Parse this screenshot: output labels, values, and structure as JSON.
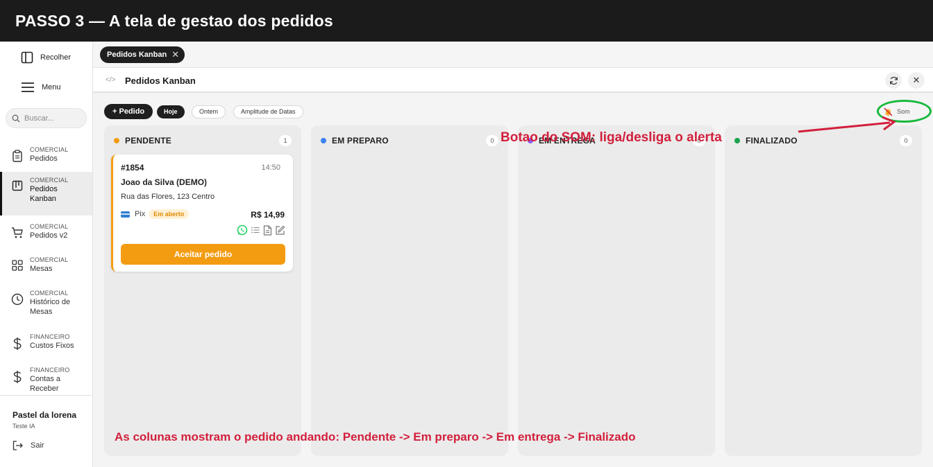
{
  "banner": {
    "title": "PASSO 3  —  A tela de gestao dos pedidos"
  },
  "sidebar": {
    "collapse_label": "Recolher",
    "menu_label": "Menu",
    "search_placeholder": "Buscar...",
    "items": [
      {
        "category": "COMERCIAL",
        "label": "Pedidos",
        "icon": "clipboard-icon",
        "active": false
      },
      {
        "category": "COMERCIAL",
        "label": "Pedidos Kanban",
        "icon": "kanban-icon",
        "active": true
      },
      {
        "category": "COMERCIAL",
        "label": "Pedidos v2",
        "icon": "cart-icon",
        "active": false
      },
      {
        "category": "COMERCIAL",
        "label": "Mesas",
        "icon": "grid-icon",
        "active": false
      },
      {
        "category": "COMERCIAL",
        "label": "Histórico de Mesas",
        "icon": "clock-icon",
        "active": false
      },
      {
        "category": "FINANCEIRO",
        "label": "Custos Fixos",
        "icon": "dollar-icon",
        "active": false
      },
      {
        "category": "FINANCEIRO",
        "label": "Contas a Receber",
        "icon": "dollar-icon",
        "active": false
      }
    ],
    "store_name": "Pastel da lorena",
    "store_sub": "Teste IA",
    "logout_label": "Sair"
  },
  "tabs": [
    {
      "label": "Pedidos Kanban"
    }
  ],
  "header": {
    "code_glyph": "</>",
    "title": "Pedidos Kanban"
  },
  "toolbar": {
    "new_label": "+ Pedido",
    "filters": [
      {
        "label": "Hoje",
        "active": true
      },
      {
        "label": "Ontem",
        "active": false
      },
      {
        "label": "Amplitude de Datas",
        "active": false
      }
    ],
    "sound_label": "Som"
  },
  "columns": [
    {
      "title": "PENDENTE",
      "count": "1",
      "color": "#f39c12"
    },
    {
      "title": "EM PREPARO",
      "count": "0",
      "color": "#3b82f6"
    },
    {
      "title": "EM ENTREGA",
      "count": "0",
      "color": "#8b5cf6"
    },
    {
      "title": "FINALIZADO",
      "count": "0",
      "color": "#16a34a"
    }
  ],
  "order": {
    "id": "#1854",
    "time": "14:50",
    "customer": "Joao da Silva (DEMO)",
    "address": "Rua das Flores, 123 Centro",
    "payment": "Pix",
    "status": "Em aberto",
    "price": "R$ 14,99",
    "accept_label": "Aceitar pedido"
  },
  "annotations": {
    "sound": "Botao do SOM: liga/desliga o alerta",
    "columns": "As colunas mostram o pedido andando: Pendente -> Em preparo -> Em entrega -> Finalizado"
  },
  "colors": {
    "accent": "#f39c12",
    "annotation": "#d21f3c",
    "highlight_ring": "#16b83b",
    "whatsapp": "#25d366"
  }
}
